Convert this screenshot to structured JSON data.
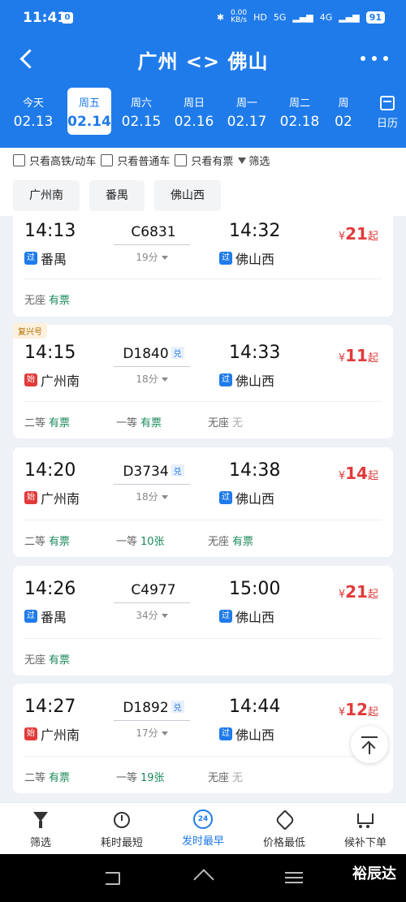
{
  "status_bar": {
    "time": "11:41",
    "badge": "0",
    "speed": "0.00",
    "speed_unit": "KB/s",
    "hd": "HD",
    "net1": "5G",
    "net2": "4G",
    "battery": "91"
  },
  "header": {
    "title": "广州 <> 佛山"
  },
  "dates": [
    {
      "weekday": "今天",
      "date": "02.13"
    },
    {
      "weekday": "周五",
      "date": "02.14"
    },
    {
      "weekday": "周六",
      "date": "02.15"
    },
    {
      "weekday": "周日",
      "date": "02.16"
    },
    {
      "weekday": "周一",
      "date": "02.17"
    },
    {
      "weekday": "周二",
      "date": "02.18"
    },
    {
      "weekday": "周",
      "date": "02"
    }
  ],
  "calendar_label": "日历",
  "filters": {
    "high_speed": "只看高铁/动车",
    "normal": "只看普通车",
    "available": "只看有票",
    "filter": "筛选"
  },
  "stations": [
    "广州南",
    "番禺",
    "佛山西"
  ],
  "trains": [
    {
      "tag": "",
      "dep_time": "14:13",
      "arr_time": "14:32",
      "train_no": "C6831",
      "dui": "",
      "duration": "19分",
      "dep_type": "过",
      "dep_station": "番禺",
      "arr_type": "过",
      "arr_station": "佛山西",
      "currency": "¥",
      "price": "21",
      "price_suffix": "起",
      "seats": [
        {
          "class": "无座",
          "status": "有票",
          "avail": true
        }
      ]
    },
    {
      "tag": "复兴号",
      "dep_time": "14:15",
      "arr_time": "14:33",
      "train_no": "D1840",
      "dui": "兑",
      "duration": "18分",
      "dep_type": "始",
      "dep_station": "广州南",
      "arr_type": "过",
      "arr_station": "佛山西",
      "currency": "¥",
      "price": "11",
      "price_suffix": "起",
      "seats": [
        {
          "class": "二等",
          "status": "有票",
          "avail": true
        },
        {
          "class": "一等",
          "status": "有票",
          "avail": true
        },
        {
          "class": "无座",
          "status": "无",
          "avail": false
        }
      ]
    },
    {
      "tag": "",
      "dep_time": "14:20",
      "arr_time": "14:38",
      "train_no": "D3734",
      "dui": "兑",
      "duration": "18分",
      "dep_type": "始",
      "dep_station": "广州南",
      "arr_type": "过",
      "arr_station": "佛山西",
      "currency": "¥",
      "price": "14",
      "price_suffix": "起",
      "seats": [
        {
          "class": "二等",
          "status": "有票",
          "avail": true
        },
        {
          "class": "一等",
          "status": "10张",
          "avail": true
        },
        {
          "class": "无座",
          "status": "有票",
          "avail": true
        }
      ]
    },
    {
      "tag": "",
      "dep_time": "14:26",
      "arr_time": "15:00",
      "train_no": "C4977",
      "dui": "",
      "duration": "34分",
      "dep_type": "过",
      "dep_station": "番禺",
      "arr_type": "过",
      "arr_station": "佛山西",
      "currency": "¥",
      "price": "21",
      "price_suffix": "起",
      "seats": [
        {
          "class": "无座",
          "status": "有票",
          "avail": true
        }
      ]
    },
    {
      "tag": "",
      "dep_time": "14:27",
      "arr_time": "14:44",
      "train_no": "D1892",
      "dui": "兑",
      "duration": "17分",
      "dep_type": "始",
      "dep_station": "广州南",
      "arr_type": "过",
      "arr_station": "佛山西",
      "currency": "¥",
      "price": "12",
      "price_suffix": "起",
      "seats": [
        {
          "class": "二等",
          "status": "有票",
          "avail": true
        },
        {
          "class": "一等",
          "status": "19张",
          "avail": true
        },
        {
          "class": "无座",
          "status": "无",
          "avail": false
        }
      ]
    }
  ],
  "tabs": [
    {
      "label": "筛选",
      "icon": "filter-icon"
    },
    {
      "label": "耗时最短",
      "icon": "timer-icon"
    },
    {
      "label": "发时最早",
      "icon": "clock-24-icon",
      "badge": "24"
    },
    {
      "label": "价格最低",
      "icon": "price-tag-icon"
    },
    {
      "label": "候补下单",
      "icon": "cart-add-icon"
    }
  ],
  "watermark": "裕辰达",
  "colors": {
    "primary": "#1f7bea",
    "price": "#e23a3a",
    "available": "#1b8a5a"
  }
}
